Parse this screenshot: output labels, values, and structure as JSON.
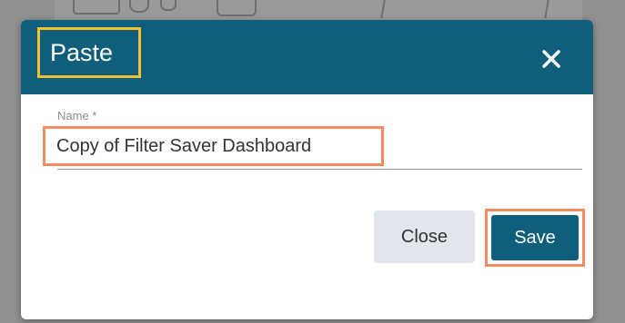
{
  "dialog": {
    "title": "Paste",
    "close_icon": "close-icon"
  },
  "form": {
    "name_label": "Name *",
    "name_value": "Copy of Filter Saver Dashboard"
  },
  "buttons": {
    "close_label": "Close",
    "save_label": "Save"
  },
  "colors": {
    "header": "#0e5e7c",
    "title_highlight": "#f2c12e",
    "field_highlight": "#f28b5e",
    "close_button_bg": "#e1e5ec",
    "save_button_bg": "#0e5e7c"
  }
}
